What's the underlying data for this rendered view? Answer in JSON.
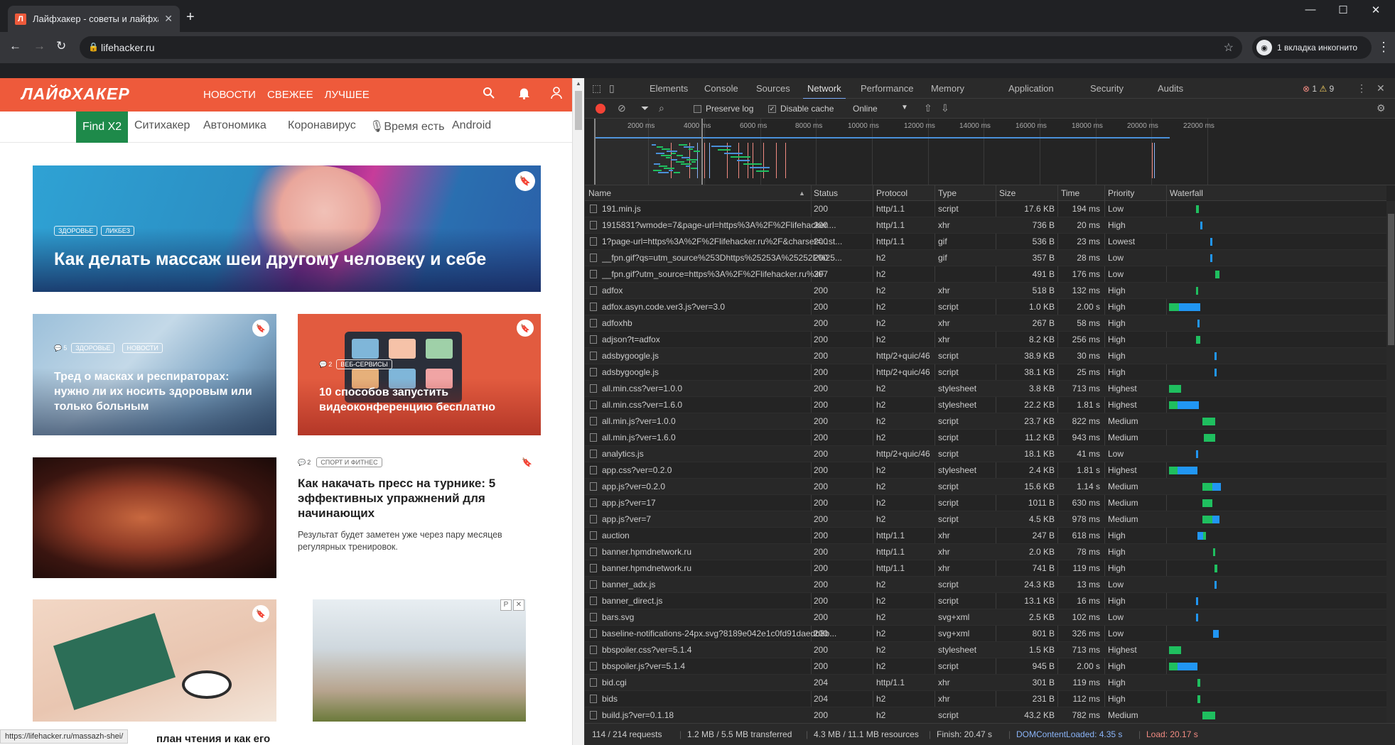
{
  "browser": {
    "tab_title": "Лайфхакер - советы и лайфхаки",
    "tab_favicon": "Л",
    "url": "lifehacker.ru",
    "incognito_label": "1 вкладка инкогнито"
  },
  "site": {
    "logo": "ЛАЙФХАКЕР",
    "topnav": [
      "НОВОСТИ",
      "СВЕЖЕЕ",
      "ЛУЧШЕЕ"
    ],
    "subnav_find": "Find X2",
    "subnav": [
      "Ситихакер",
      "Автономика",
      "Коронавирус",
      "🎙Время есть",
      "Android"
    ],
    "hero": {
      "tags": [
        "ЗДОРОВЬЕ",
        "ЛИКБЕЗ"
      ],
      "title": "Как делать массаж шеи другому человеку и себе"
    },
    "card1": {
      "comments": "5",
      "tags": [
        "ЗДОРОВЬЕ",
        "НОВОСТИ"
      ],
      "title": "Тред о масках и респираторах: нужно ли их носить здоровым или только больным"
    },
    "card2": {
      "comments": "2",
      "tags": [
        "ВЕБ-СЕРВИСЫ"
      ],
      "title": "10 способов запустить видеоконференцию бесплатно"
    },
    "article": {
      "comments": "2",
      "tag": "СПОРТ И ФИТНЕС",
      "title": "Как накачать пресс на турнике: 5 эффективных упражнений для начинающих",
      "lead": "Результат будет заметен уже через пару месяцев регулярных тренировок."
    },
    "cut_title": "план чтения и как его",
    "status_url": "https://lifehacker.ru/massazh-shei/"
  },
  "devtools": {
    "tabs": [
      "Elements",
      "Console",
      "Sources",
      "Network",
      "Performance",
      "Memory",
      "Application",
      "Security",
      "Audits"
    ],
    "active_tab": "Network",
    "errors": "1",
    "warnings": "9",
    "preserve_log": "Preserve log",
    "disable_cache": "Disable cache",
    "throttle": "Online",
    "timeline_ticks": [
      "2000 ms",
      "4000 ms",
      "6000 ms",
      "8000 ms",
      "10000 ms",
      "12000 ms",
      "14000 ms",
      "16000 ms",
      "18000 ms",
      "20000 ms",
      "22000 ms"
    ],
    "columns": [
      "Name",
      "Status",
      "Protocol",
      "Type",
      "Size",
      "Time",
      "Priority",
      "Waterfall"
    ],
    "requests": [
      {
        "name": "191.min.js",
        "status": "200",
        "protocol": "http/1.1",
        "type": "script",
        "size": "17.6 KB",
        "time": "194 ms",
        "priority": "Low"
      },
      {
        "name": "1915831?wmode=7&page-url=https%3A%2F%2Flifehacker....",
        "status": "200",
        "protocol": "http/1.1",
        "type": "xhr",
        "size": "736 B",
        "time": "20 ms",
        "priority": "High"
      },
      {
        "name": "1?page-url=https%3A%2F%2Flifehacker.ru%2F&charset=...st...",
        "status": "200",
        "protocol": "http/1.1",
        "type": "gif",
        "size": "536 B",
        "time": "23 ms",
        "priority": "Lowest"
      },
      {
        "name": "__fpn.gif?qs=utm_source%253Dhttps%25253A%25252F%25...",
        "status": "200",
        "protocol": "h2",
        "type": "gif",
        "size": "357 B",
        "time": "28 ms",
        "priority": "Low"
      },
      {
        "name": "__fpn.gif?utm_source=https%3A%2F%2Flifehacker.ru%2F",
        "status": "307",
        "protocol": "h2",
        "type": "",
        "size": "491 B",
        "time": "176 ms",
        "priority": "Low"
      },
      {
        "name": "adfox",
        "status": "200",
        "protocol": "h2",
        "type": "xhr",
        "size": "518 B",
        "time": "132 ms",
        "priority": "High"
      },
      {
        "name": "adfox.asyn.code.ver3.js?ver=3.0",
        "status": "200",
        "protocol": "h2",
        "type": "script",
        "size": "1.0 KB",
        "time": "2.00 s",
        "priority": "High"
      },
      {
        "name": "adfoxhb",
        "status": "200",
        "protocol": "h2",
        "type": "xhr",
        "size": "267 B",
        "time": "58 ms",
        "priority": "High"
      },
      {
        "name": "adjson?t=adfox",
        "status": "200",
        "protocol": "h2",
        "type": "xhr",
        "size": "8.2 KB",
        "time": "256 ms",
        "priority": "High"
      },
      {
        "name": "adsbygoogle.js",
        "status": "200",
        "protocol": "http/2+quic/46",
        "type": "script",
        "size": "38.9 KB",
        "time": "30 ms",
        "priority": "High"
      },
      {
        "name": "adsbygoogle.js",
        "status": "200",
        "protocol": "http/2+quic/46",
        "type": "script",
        "size": "38.1 KB",
        "time": "25 ms",
        "priority": "High"
      },
      {
        "name": "all.min.css?ver=1.0.0",
        "status": "200",
        "protocol": "h2",
        "type": "stylesheet",
        "size": "3.8 KB",
        "time": "713 ms",
        "priority": "Highest"
      },
      {
        "name": "all.min.css?ver=1.6.0",
        "status": "200",
        "protocol": "h2",
        "type": "stylesheet",
        "size": "22.2 KB",
        "time": "1.81 s",
        "priority": "Highest"
      },
      {
        "name": "all.min.js?ver=1.0.0",
        "status": "200",
        "protocol": "h2",
        "type": "script",
        "size": "23.7 KB",
        "time": "822 ms",
        "priority": "Medium"
      },
      {
        "name": "all.min.js?ver=1.6.0",
        "status": "200",
        "protocol": "h2",
        "type": "script",
        "size": "11.2 KB",
        "time": "943 ms",
        "priority": "Medium"
      },
      {
        "name": "analytics.js",
        "status": "200",
        "protocol": "http/2+quic/46",
        "type": "script",
        "size": "18.1 KB",
        "time": "41 ms",
        "priority": "Low"
      },
      {
        "name": "app.css?ver=0.2.0",
        "status": "200",
        "protocol": "h2",
        "type": "stylesheet",
        "size": "2.4 KB",
        "time": "1.81 s",
        "priority": "Highest"
      },
      {
        "name": "app.js?ver=0.2.0",
        "status": "200",
        "protocol": "h2",
        "type": "script",
        "size": "15.6 KB",
        "time": "1.14 s",
        "priority": "Medium"
      },
      {
        "name": "app.js?ver=17",
        "status": "200",
        "protocol": "h2",
        "type": "script",
        "size": "1011 B",
        "time": "630 ms",
        "priority": "Medium"
      },
      {
        "name": "app.js?ver=7",
        "status": "200",
        "protocol": "h2",
        "type": "script",
        "size": "4.5 KB",
        "time": "978 ms",
        "priority": "Medium"
      },
      {
        "name": "auction",
        "status": "200",
        "protocol": "http/1.1",
        "type": "xhr",
        "size": "247 B",
        "time": "618 ms",
        "priority": "High"
      },
      {
        "name": "banner.hpmdnetwork.ru",
        "status": "200",
        "protocol": "http/1.1",
        "type": "xhr",
        "size": "2.0 KB",
        "time": "78 ms",
        "priority": "High"
      },
      {
        "name": "banner.hpmdnetwork.ru",
        "status": "200",
        "protocol": "http/1.1",
        "type": "xhr",
        "size": "741 B",
        "time": "119 ms",
        "priority": "High"
      },
      {
        "name": "banner_adx.js",
        "status": "200",
        "protocol": "h2",
        "type": "script",
        "size": "24.3 KB",
        "time": "13 ms",
        "priority": "Low"
      },
      {
        "name": "banner_direct.js",
        "status": "200",
        "protocol": "h2",
        "type": "script",
        "size": "13.1 KB",
        "time": "16 ms",
        "priority": "High"
      },
      {
        "name": "bars.svg",
        "status": "200",
        "protocol": "h2",
        "type": "svg+xml",
        "size": "2.5 KB",
        "time": "102 ms",
        "priority": "Low"
      },
      {
        "name": "baseline-notifications-24px.svg?8189e042e1c0fd91daedb8b...",
        "status": "200",
        "protocol": "h2",
        "type": "svg+xml",
        "size": "801 B",
        "time": "326 ms",
        "priority": "Low"
      },
      {
        "name": "bbspoiler.css?ver=5.1.4",
        "status": "200",
        "protocol": "h2",
        "type": "stylesheet",
        "size": "1.5 KB",
        "time": "713 ms",
        "priority": "Highest"
      },
      {
        "name": "bbspoiler.js?ver=5.1.4",
        "status": "200",
        "protocol": "h2",
        "type": "script",
        "size": "945 B",
        "time": "2.00 s",
        "priority": "High"
      },
      {
        "name": "bid.cgi",
        "status": "204",
        "protocol": "http/1.1",
        "type": "xhr",
        "size": "301 B",
        "time": "119 ms",
        "priority": "High"
      },
      {
        "name": "bids",
        "status": "204",
        "protocol": "h2",
        "type": "xhr",
        "size": "231 B",
        "time": "112 ms",
        "priority": "High"
      },
      {
        "name": "build.js?ver=0.1.18",
        "status": "200",
        "protocol": "h2",
        "type": "script",
        "size": "43.2 KB",
        "time": "782 ms",
        "priority": "Medium"
      }
    ],
    "status": {
      "requests": "114 / 214 requests",
      "transferred": "1.2 MB / 5.5 MB transferred",
      "resources": "4.3 MB / 11.1 MB resources",
      "finish": "Finish: 20.47 s",
      "dcl": "DOMContentLoaded: 4.35 s",
      "load": "Load: 20.17 s"
    }
  }
}
